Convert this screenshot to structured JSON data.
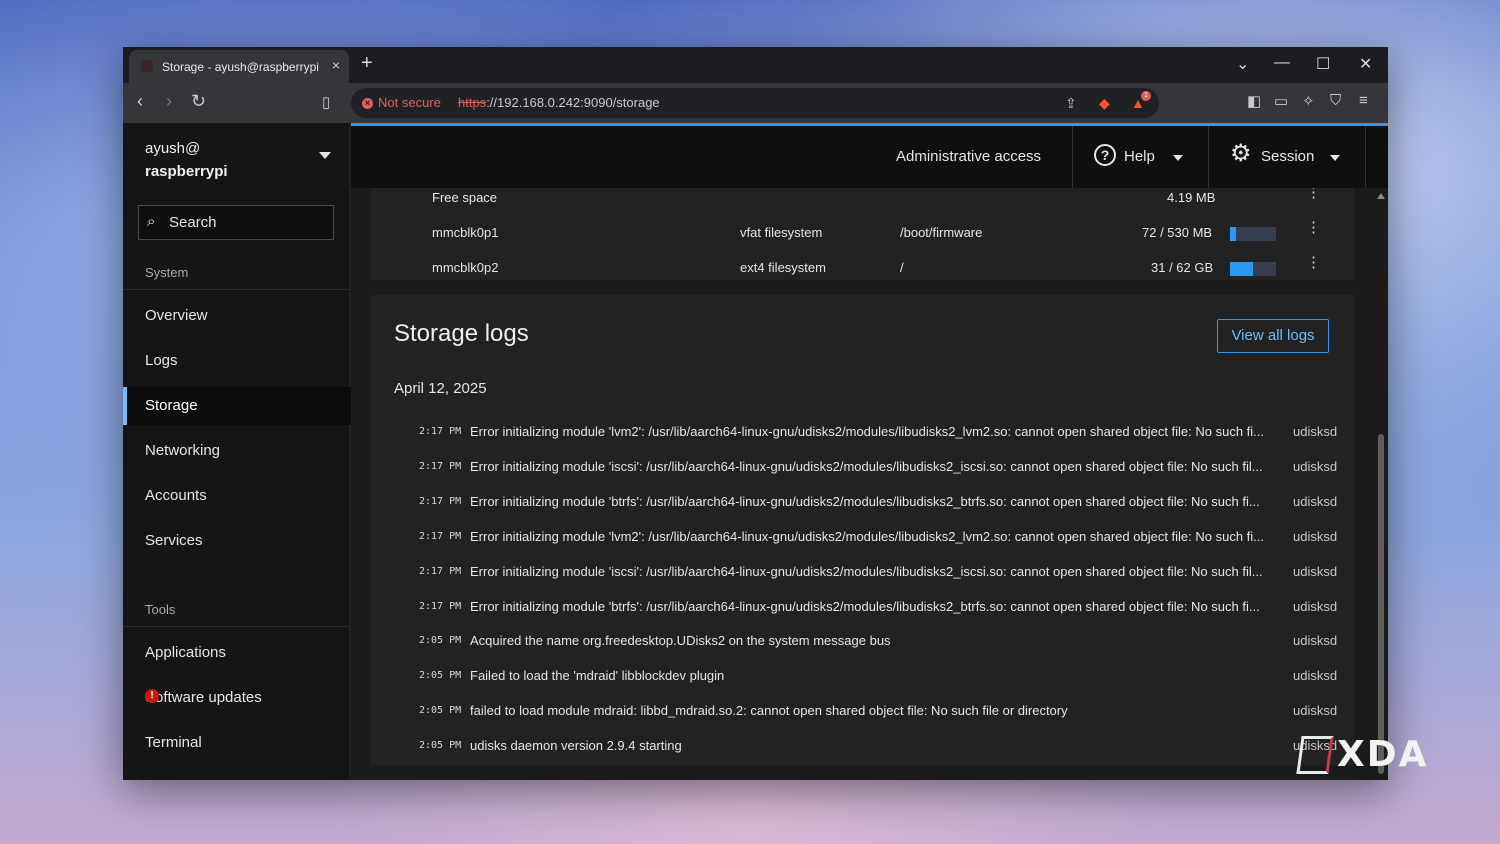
{
  "browser": {
    "tab_title": "Storage - ayush@raspberrypi",
    "tab_close": "×",
    "new_tab": "+",
    "not_secure": "Not secure",
    "url_scheme": "https",
    "url_rest": "://192.168.0.242:9090/storage",
    "brave_badge": "1"
  },
  "sidebar": {
    "user": "ayush@",
    "host": "raspberrypi",
    "search_placeholder": "Search",
    "system_label": "System",
    "system_items": [
      "Overview",
      "Logs",
      "Storage",
      "Networking",
      "Accounts",
      "Services"
    ],
    "active_item": "Storage",
    "tools_label": "Tools",
    "tools_items": [
      "Applications",
      "Software updates",
      "Terminal"
    ],
    "updates_badge": "!"
  },
  "header": {
    "admin": "Administrative access",
    "help": "Help",
    "session": "Session"
  },
  "filesystems": [
    {
      "device": "Free space",
      "type": "",
      "mount": "",
      "size": "4.19 MB",
      "usage": null
    },
    {
      "device": "mmcblk0p1",
      "type": "vfat filesystem",
      "mount": "/boot/firmware",
      "size": "72 / 530 MB",
      "usage": 0.14
    },
    {
      "device": "mmcblk0p2",
      "type": "ext4 filesystem",
      "mount": "/",
      "size": "31 / 62 GB",
      "usage": 0.5
    }
  ],
  "logs": {
    "title": "Storage logs",
    "view_all": "View all logs",
    "date": "April 12, 2025",
    "entries": [
      {
        "time": "2:17 PM",
        "message": "Error initializing module 'lvm2': /usr/lib/aarch64-linux-gnu/udisks2/modules/libudisks2_lvm2.so: cannot open shared object file: No such fi...",
        "source": "udisksd"
      },
      {
        "time": "2:17 PM",
        "message": "Error initializing module 'iscsi': /usr/lib/aarch64-linux-gnu/udisks2/modules/libudisks2_iscsi.so: cannot open shared object file: No such fil...",
        "source": "udisksd"
      },
      {
        "time": "2:17 PM",
        "message": "Error initializing module 'btrfs': /usr/lib/aarch64-linux-gnu/udisks2/modules/libudisks2_btrfs.so: cannot open shared object file: No such fi...",
        "source": "udisksd"
      },
      {
        "time": "2:17 PM",
        "message": "Error initializing module 'lvm2': /usr/lib/aarch64-linux-gnu/udisks2/modules/libudisks2_lvm2.so: cannot open shared object file: No such fi...",
        "source": "udisksd"
      },
      {
        "time": "2:17 PM",
        "message": "Error initializing module 'iscsi': /usr/lib/aarch64-linux-gnu/udisks2/modules/libudisks2_iscsi.so: cannot open shared object file: No such fil...",
        "source": "udisksd"
      },
      {
        "time": "2:17 PM",
        "message": "Error initializing module 'btrfs': /usr/lib/aarch64-linux-gnu/udisks2/modules/libudisks2_btrfs.so: cannot open shared object file: No such fi...",
        "source": "udisksd"
      },
      {
        "time": "2:05 PM",
        "message": "Acquired the name org.freedesktop.UDisks2 on the system message bus",
        "source": "udisksd"
      },
      {
        "time": "2:05 PM",
        "message": "Failed to load the 'mdraid' libblockdev plugin",
        "source": "udisksd"
      },
      {
        "time": "2:05 PM",
        "message": "failed to load module mdraid: libbd_mdraid.so.2: cannot open shared object file: No such file or directory",
        "source": "udisksd"
      },
      {
        "time": "2:05 PM",
        "message": "udisks daemon version 2.9.4 starting",
        "source": "udisksd"
      }
    ]
  },
  "watermark": "XDA"
}
